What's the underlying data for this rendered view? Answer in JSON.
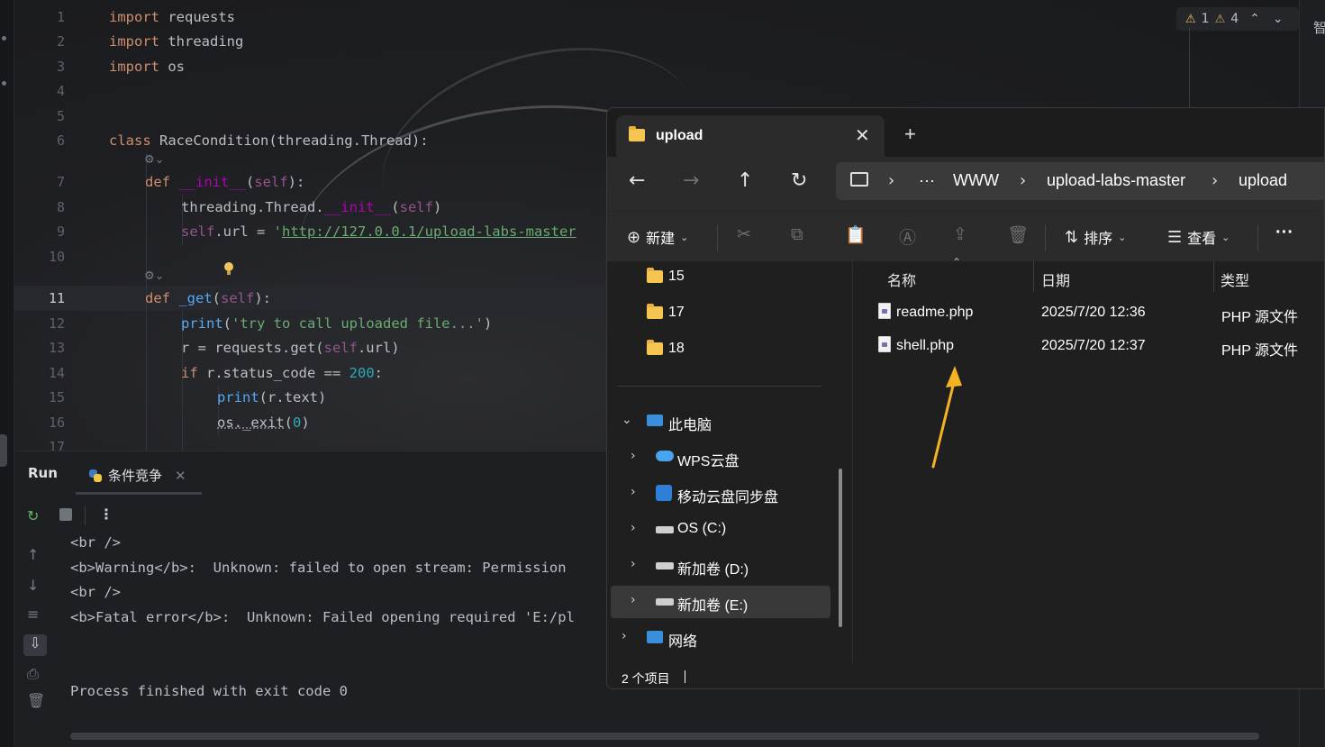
{
  "editor": {
    "line_numbers": [
      "1",
      "2",
      "3",
      "4",
      "5",
      "6",
      "7",
      "8",
      "9",
      "10",
      "11",
      "12",
      "13",
      "14",
      "15",
      "16",
      "17"
    ],
    "current_line": "11",
    "code": {
      "l1_kw": "import",
      "l1_rest": " requests",
      "l2_kw": "import",
      "l2_rest": " threading",
      "l3_kw": "import",
      "l3_rest": " os",
      "l6_kw": "class",
      "l6_rest": " RaceCondition(threading.Thread):",
      "l7_kw": "def",
      "l7_sp": " ",
      "l7_fn": "__init__",
      "l7_a": "(",
      "l7_self": "self",
      "l7_b": "):",
      "l8_a": "threading.Thread.",
      "l8_dund": "__init__",
      "l8_b": "(",
      "l8_self": "self",
      "l8_c": ")",
      "l9_self": "self",
      "l9_a": ".url = ",
      "l9_q": "'",
      "l9_url": "http://127.0.0.1/upload-labs-master",
      "l11_kw": "def",
      "l11_sp": " ",
      "l11_fn": "_get",
      "l11_a": "(",
      "l11_self": "self",
      "l11_b": "):",
      "l12_fn": "print",
      "l12_a": "(",
      "l12_str": "'try to call uploaded file...'",
      "l12_b": ")",
      "l13_a": "r = requests.get(",
      "l13_self": "self",
      "l13_b": ".url)",
      "l14_kw": "if",
      "l14_a": " r.status_code == ",
      "l14_num": "200",
      "l14_b": ":",
      "l15_fn": "print",
      "l15_a": "(r.text)",
      "l16_a": "os.",
      "l16_fn": "_exit",
      "l16_b": "(",
      "l16_num": "0",
      "l16_c": ")"
    },
    "inspection": {
      "warning_count": "1",
      "weak_warning_count": "4"
    },
    "right_edge_char": "智"
  },
  "run_panel": {
    "title": "Run",
    "tab_label": "条件竞争",
    "console": [
      "<br />",
      "<b>Warning</b>:  Unknown: failed to open stream: Permission",
      "<br />",
      "<b>Fatal error</b>:  Unknown: Failed opening required 'E:/pl",
      "",
      "",
      "Process finished with exit code 0"
    ]
  },
  "explorer": {
    "tab_title": "upload",
    "breadcrumb": [
      "WWW",
      "upload-labs-master",
      "upload"
    ],
    "ellipsis": "···",
    "commands": {
      "new": "新建",
      "sort": "排序",
      "view": "查看",
      "more": "···"
    },
    "nav_items": {
      "f15": "15",
      "f17": "17",
      "f18": "18",
      "this_pc": "此电脑",
      "wps": "WPS云盘",
      "yidong": "移动云盘同步盘",
      "os_c": "OS (C:)",
      "vol_d": "新加卷 (D:)",
      "vol_e": "新加卷 (E:)",
      "network": "网络"
    },
    "columns": {
      "name": "名称",
      "date": "日期",
      "type": "类型"
    },
    "files": [
      {
        "name": "readme.php",
        "date": "2025/7/20 12:36",
        "type": "PHP 源文件"
      },
      {
        "name": "shell.php",
        "date": "2025/7/20 12:37",
        "type": "PHP 源文件"
      }
    ],
    "status": "2 个项目"
  },
  "colors": {
    "keyword": "#cf8e6d",
    "function": "#56a8f5",
    "self": "#94558d",
    "string": "#6aab73",
    "number": "#2aacb8",
    "dunder": "#b200b2",
    "folder": "#f6c451",
    "annotation_arrow": "#f5b324"
  }
}
